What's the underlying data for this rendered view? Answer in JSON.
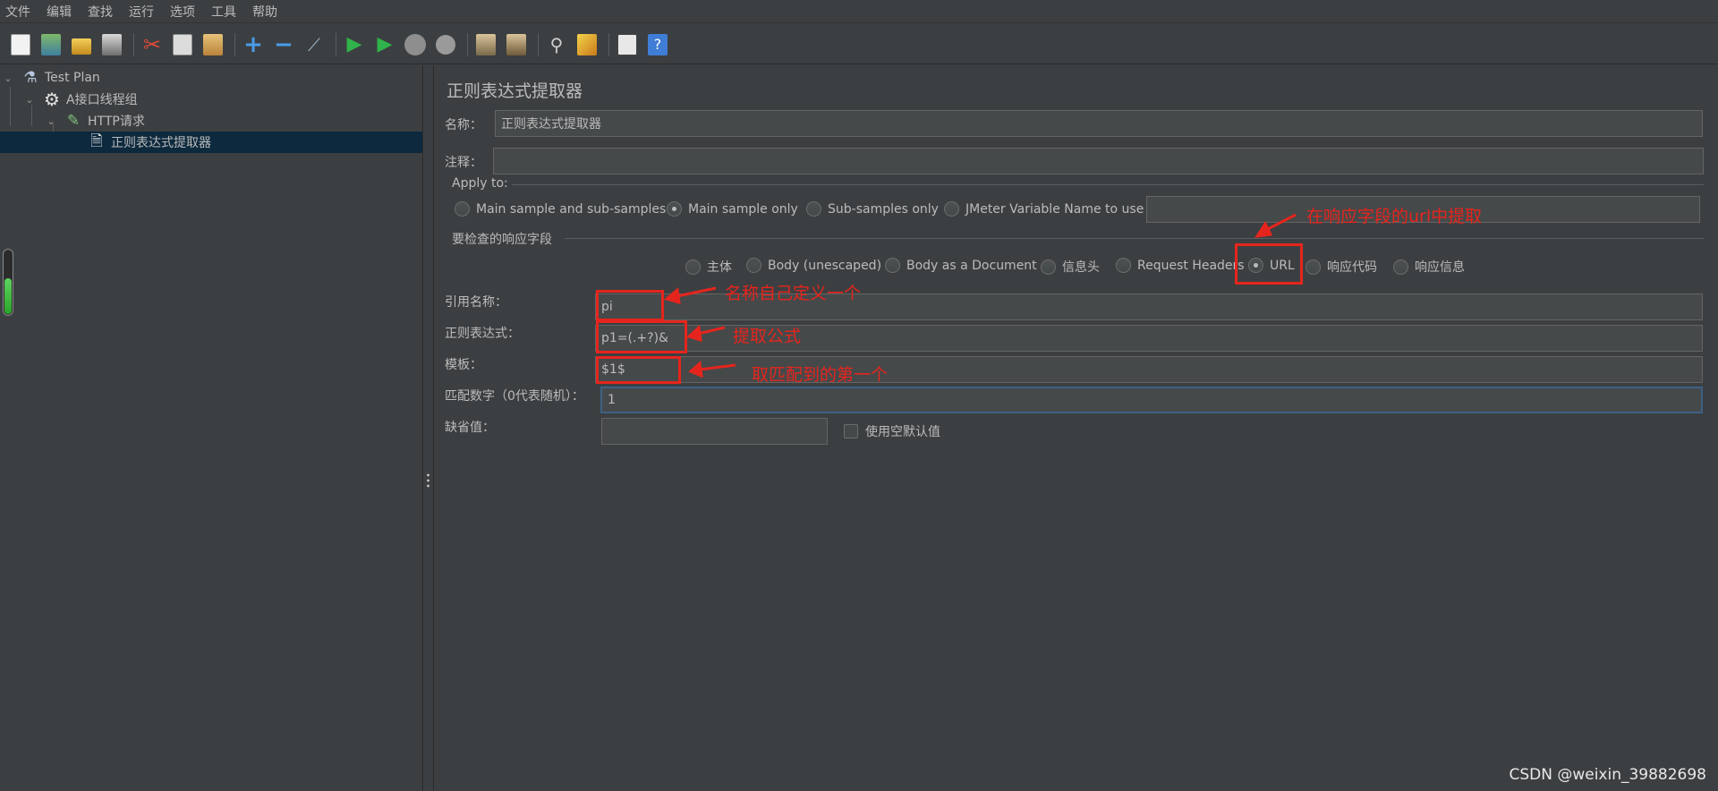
{
  "menu": [
    "文件",
    "编辑",
    "查找",
    "运行",
    "选项",
    "工具",
    "帮助"
  ],
  "toolbar_icons": [
    "new-icon",
    "templates-icon",
    "open-icon",
    "save-icon",
    "cut-icon",
    "copy-icon",
    "paste-icon",
    "expand-icon",
    "collapse-icon",
    "toggle-icon",
    "start-icon",
    "start-no-pause-icon",
    "stop-icon",
    "shutdown-icon",
    "clear-icon",
    "clear-all-icon",
    "search-icon",
    "reset-search-icon",
    "function-helper-icon",
    "help-icon"
  ],
  "tree": {
    "test_plan": "Test Plan",
    "thread_group": "A接口线程组",
    "http_request": "HTTP请求",
    "extractor": "正则表达式提取器"
  },
  "panel": {
    "title": "正则表达式提取器",
    "name_label": "名称：",
    "name_value": "正则表达式提取器",
    "comment_label": "注释：",
    "comment_value": "",
    "apply_to_label": "Apply to:",
    "apply_options": [
      "Main sample and sub-samples",
      "Main sample only",
      "Sub-samples only",
      "JMeter Variable Name to use"
    ],
    "apply_selected": "Main sample only",
    "jmeter_var_value": "",
    "field_group_label": "要检查的响应字段",
    "field_options": [
      "主体",
      "Body (unescaped)",
      "Body as a Document",
      "信息头",
      "Request Headers",
      "URL",
      "响应代码",
      "响应信息"
    ],
    "field_selected": "URL",
    "ref_name_label": "引用名称：",
    "ref_name_value": "pi",
    "regex_label": "正则表达式：",
    "regex_value": "p1=(.+?)&",
    "template_label": "模板：",
    "template_value": "$1$",
    "match_no_label": "匹配数字（0代表随机）：",
    "match_no_value": "1",
    "default_label": "缺省值：",
    "default_value": "",
    "use_empty_default_label": "使用空默认值"
  },
  "annotations": {
    "url_note": "在响应字段的url中提取",
    "name_note": "名称自己定义一个",
    "regex_note": "提取公式",
    "template_note": "取匹配到的第一个"
  },
  "memory_usage": 0.55,
  "watermark": "CSDN @weixin_39882698"
}
